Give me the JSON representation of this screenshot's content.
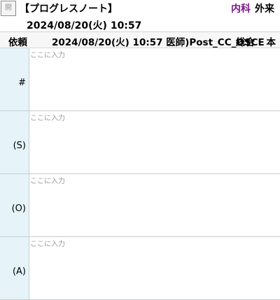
{
  "header": {
    "open_button_label": "開",
    "title": "【プログレスノート】",
    "department": "内科",
    "visit_type": "外来",
    "datetime": "2024/08/20(火) 10:57"
  },
  "request_bar": {
    "label": "依頼",
    "meta": "2024/08/20(火) 10:57 医師)Post_CC_OSCE",
    "kind": "総合",
    "book": "本"
  },
  "sections": [
    {
      "label": "#",
      "placeholder": "ここに入力"
    },
    {
      "label": "(S)",
      "placeholder": "ここに入力"
    },
    {
      "label": "(O)",
      "placeholder": "ここに入力"
    },
    {
      "label": "(A)",
      "placeholder": "ここに入力"
    }
  ]
}
